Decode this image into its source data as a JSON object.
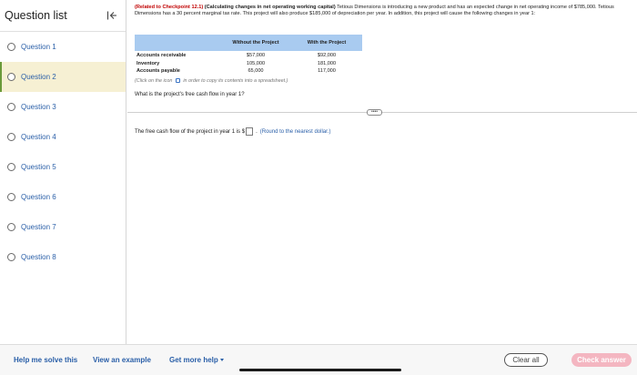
{
  "sidebar": {
    "title": "Question list",
    "questions": [
      {
        "label": "Question 1"
      },
      {
        "label": "Question 2"
      },
      {
        "label": "Question 3"
      },
      {
        "label": "Question 4"
      },
      {
        "label": "Question 5"
      },
      {
        "label": "Question 6"
      },
      {
        "label": "Question 7"
      },
      {
        "label": "Question 8"
      }
    ],
    "selected_index": 1
  },
  "problem": {
    "reference": "(Related to Checkpoint 12.1)",
    "topic": "(Calculating changes in net operating working capital)",
    "text": "Tetious Dimensions is introducing a new product and has an expected change in net operating income of $785,000. Tetious Dimensions has a 30 percent marginal tax rate. This project will also produce $185,000 of depreciation per year. In addition, this project will cause the following changes in year 1:"
  },
  "table": {
    "headers": [
      "",
      "Without the Project",
      "With the Project"
    ],
    "rows": [
      {
        "label": "Accounts receivable",
        "without": "$57,000",
        "with": "$92,000"
      },
      {
        "label": "Inventory",
        "without": "105,000",
        "with": "181,000"
      },
      {
        "label": "Accounts payable",
        "without": "65,000",
        "with": "117,000"
      }
    ]
  },
  "copy_hint": {
    "before": "(Click on the icon",
    "after": "in order to copy its contents into a spreadsheet.)"
  },
  "question_text": "What is the project's free cash flow in year 1?",
  "answer": {
    "prefix": "The free cash flow of the project in year 1 is $",
    "value": "",
    "suffix": ".",
    "hint": "(Round to the nearest dollar.)"
  },
  "more_button": "••••",
  "footer": {
    "help": "Help me solve this",
    "example": "View an example",
    "more_help": "Get more help",
    "clear": "Clear all",
    "check": "Check answer"
  },
  "colors": {
    "link": "#2a5fa8",
    "reference_red": "#c00000",
    "table_header": "#a9cbf0",
    "selected_bg": "#f6f0d3",
    "check_button": "#f4b6c1"
  }
}
